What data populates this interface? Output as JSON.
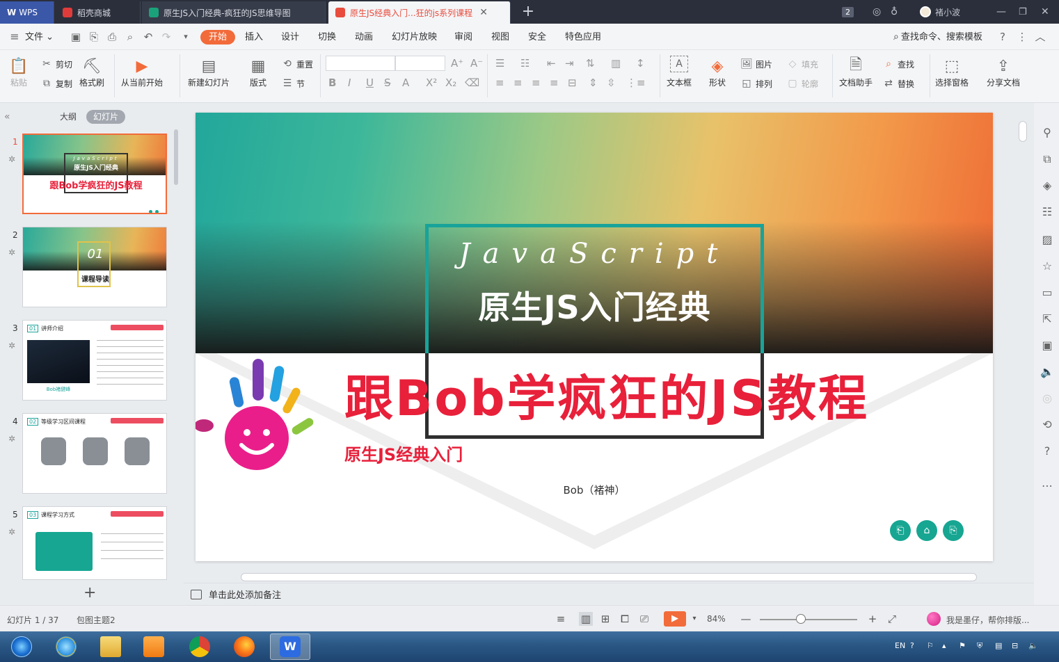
{
  "tabs": [
    {
      "label": "WPS",
      "icon": "wps-logo-icon",
      "color": "#2f6bd8"
    },
    {
      "label": "稻壳商城",
      "icon": "docer-icon",
      "color": "#e03b3b"
    },
    {
      "label": "原生JS入门经典-疯狂的JS思维导图",
      "icon": "mindmap-icon",
      "color": "#1aa27a"
    },
    {
      "label": "原生JS经典入门...狂的js系列课程",
      "icon": "ppt-icon",
      "color": "#e84c3d"
    }
  ],
  "titlebar": {
    "window_count": "2",
    "user_name": "褚小波"
  },
  "menu": {
    "file": "文件",
    "items": [
      "开始",
      "插入",
      "设计",
      "切换",
      "动画",
      "幻灯片放映",
      "审阅",
      "视图",
      "安全",
      "特色应用"
    ],
    "search": "查找命令、搜索模板",
    "help": "?"
  },
  "ribbon": {
    "paste": "粘贴",
    "cut": "剪切",
    "copy": "复制",
    "format_painter": "格式刷",
    "from_current": "从当前开始",
    "new_slide": "新建幻灯片",
    "layout": "版式",
    "reset": "重置",
    "section": "节",
    "textbox": "文本框",
    "shape": "形状",
    "picture": "图片",
    "arrange": "排列",
    "fill": "填充",
    "outline": "轮廓",
    "doc_assistant": "文档助手",
    "find": "查找",
    "replace": "替换",
    "select_pane": "选择窗格",
    "share": "分享文档"
  },
  "leftpanel": {
    "tab_outline": "大纲",
    "tab_slides": "幻灯片",
    "thumbnails": [
      {
        "num": "1",
        "line1": "JavaScript",
        "line2": "原生JS入门经典",
        "line3": "跟Bob学疯狂的JS教程"
      },
      {
        "num": "2",
        "line1": "01",
        "line2": "课程导读"
      },
      {
        "num": "3",
        "line1": "讲师介绍",
        "line2": "Bob褚健峰"
      },
      {
        "num": "4",
        "line1": "等级学习区间课程"
      },
      {
        "num": "5",
        "line1": "课程学习方式"
      }
    ],
    "add": "+"
  },
  "slide": {
    "title_en": "JavaScript",
    "title_cn": "原生JS入门经典",
    "headline": "跟Bob学疯狂的JS教程",
    "subtitle": "原生JS经典入门",
    "author": "Bob（褚神）"
  },
  "notes": {
    "placeholder": "单击此处添加备注"
  },
  "status": {
    "slide_counter": "幻灯片 1 / 37",
    "theme": "包图主题2",
    "zoom": "84%",
    "assistant": "我是墨仔，帮你排版..."
  },
  "taskbar": {
    "items": [
      "start",
      "ie",
      "explorer",
      "media",
      "chrome",
      "firefox",
      "wps"
    ],
    "lang": "EN"
  },
  "colors": {
    "accent": "#f26b3a",
    "teal": "#18a39a",
    "headline_red": "#e8203a"
  }
}
